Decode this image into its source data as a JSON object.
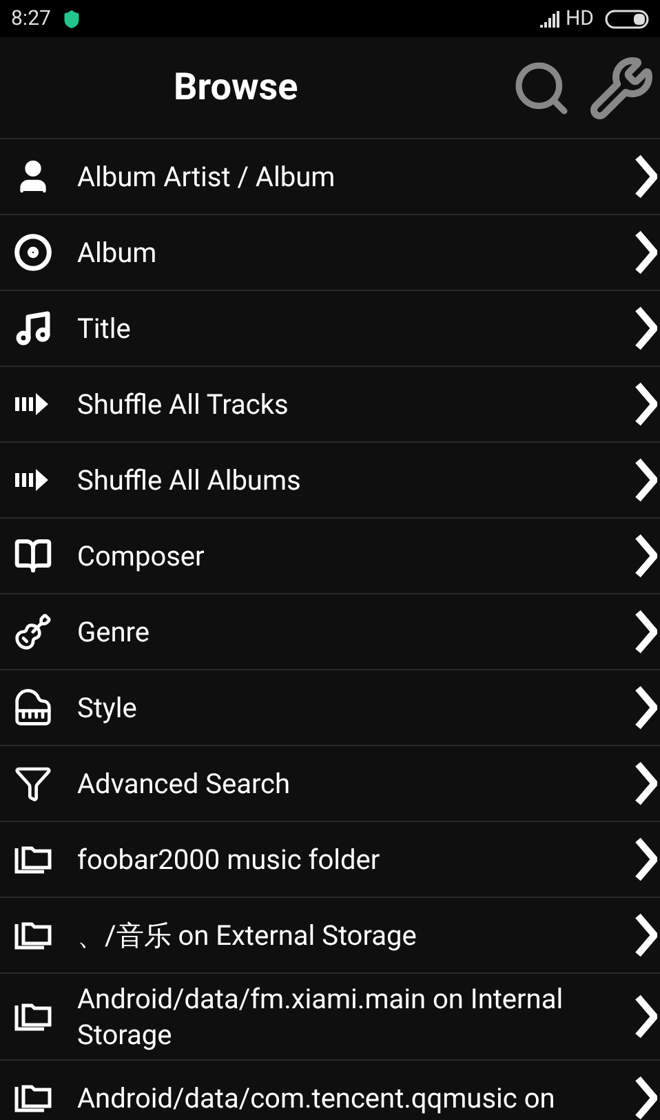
{
  "status_bar": {
    "time": "8:27",
    "network": "HD"
  },
  "header": {
    "title": "Browse"
  },
  "items": [
    {
      "label": "Album Artist / Album",
      "kind": "person"
    },
    {
      "label": "Album",
      "kind": "disc"
    },
    {
      "label": "Title",
      "kind": "note"
    },
    {
      "label": "Shuffle All Tracks",
      "kind": "shuffle"
    },
    {
      "label": "Shuffle All Albums",
      "kind": "shuffle"
    },
    {
      "label": "Composer",
      "kind": "book"
    },
    {
      "label": "Genre",
      "kind": "guitar"
    },
    {
      "label": "Style",
      "kind": "piano"
    },
    {
      "label": "Advanced Search",
      "kind": "filter"
    },
    {
      "label": "foobar2000 music folder",
      "kind": "folder"
    },
    {
      "label": "、/音乐 on External Storage",
      "kind": "folder"
    },
    {
      "label": "Android/data/fm.xiami.main on Internal Storage",
      "kind": "folder"
    },
    {
      "label": "Android/data/com.tencent.qqmusic on",
      "kind": "folder"
    }
  ]
}
